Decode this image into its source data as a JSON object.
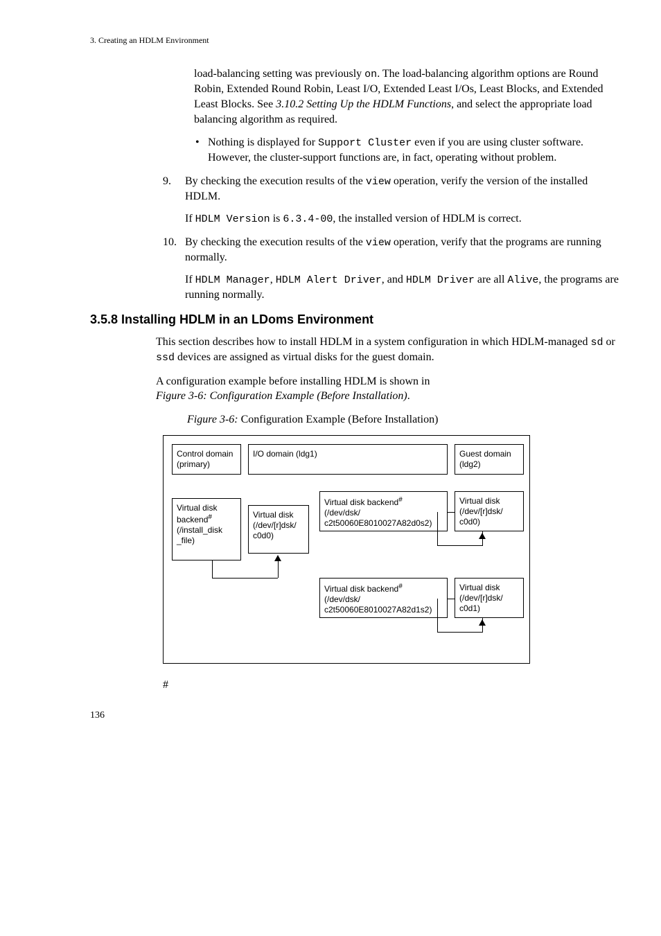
{
  "header": {
    "chapter": "3. Creating an HDLM Environment"
  },
  "p1": {
    "a": "load-balancing setting was previously ",
    "b": "on",
    "c": ". The load-balancing algorithm options are Round Robin, Extended Round Robin, Least I/O, Extended Least I/Os, Least Blocks, and Extended Least Blocks. See ",
    "d": "3.10.2  Setting Up the HDLM Functions",
    "e": ", and select the appropriate load balancing algorithm as required."
  },
  "p2": {
    "a": "Nothing is displayed for ",
    "b": "Support Cluster",
    "c": " even if you are using cluster software. However, the cluster-support functions are, in fact, operating without problem."
  },
  "step9": {
    "num": "9.",
    "text_a": "By checking the execution results of the ",
    "text_b": "view",
    "text_c": " operation, verify the version of the installed HDLM.",
    "sub_a": "If ",
    "sub_b": "HDLM Version",
    "sub_c": " is ",
    "sub_d": "6.3.4-00",
    "sub_e": ", the installed version of HDLM is correct."
  },
  "step10": {
    "num": "10.",
    "text_a": "By checking the execution results of the ",
    "text_b": "view",
    "text_c": " operation, verify that the programs are running normally.",
    "sub_a": "If ",
    "sub_b": "HDLM Manager",
    "sub_c": ", ",
    "sub_d": "HDLM Alert Driver",
    "sub_e": ", and ",
    "sub_f": "HDLM Driver",
    "sub_g": " are all ",
    "sub_h": "Alive",
    "sub_i": ", the programs are running normally."
  },
  "section_title": "3.5.8 Installing HDLM in an LDoms Environment",
  "intro1_a": "This section describes how to install HDLM in a system configuration in which HDLM-managed ",
  "intro1_b": "sd",
  "intro1_c": " or ",
  "intro1_d": "ssd",
  "intro1_e": " devices are assigned as virtual disks for the guest domain.",
  "intro2_a": "A configuration example before installing HDLM is shown in ",
  "intro2_b": "Figure  3-6:  Configuration Example (Before Installation)",
  "intro2_c": ".",
  "caption_a": "Figure  3-6:",
  "caption_b": "  Configuration Example (Before Installation)",
  "figure": {
    "control_domain_l1": "Control domain",
    "control_domain_l2": "(primary)",
    "io_domain": "I/O domain (ldg1)",
    "guest_domain_l1": "Guest domain",
    "guest_domain_l2": "(ldg2)",
    "vd_backend_file_l1": "Virtual disk",
    "vd_backend_file_l2": "backend",
    "vd_backend_file_l3": "(/install_disk",
    "vd_backend_file_l4": "_file)",
    "vd_rdsk_l1": "Virtual disk",
    "vd_rdsk_l2": "(/dev/[r]dsk/",
    "vd_rdsk_l3": "c0d0)",
    "vd_backend1_l1": "Virtual disk backend",
    "vd_backend1_l2": "(/dev/dsk/",
    "vd_backend1_l3": "c2t50060E8010027A82d0s2)",
    "vd_backend2_l1": "Virtual disk backend",
    "vd_backend2_l2": "(/dev/dsk/",
    "vd_backend2_l3": "c2t50060E8010027A82d1s2)",
    "vd_guest1_l1": "Virtual disk",
    "vd_guest1_l2": "(/dev/[r]dsk/",
    "vd_guest1_l3": "c0d0)",
    "vd_guest2_l1": "Virtual disk",
    "vd_guest2_l2": "(/dev/[r]dsk/",
    "vd_guest2_l3": "c0d1)",
    "note_marker": "#"
  },
  "hash": "#",
  "page_number": "136"
}
